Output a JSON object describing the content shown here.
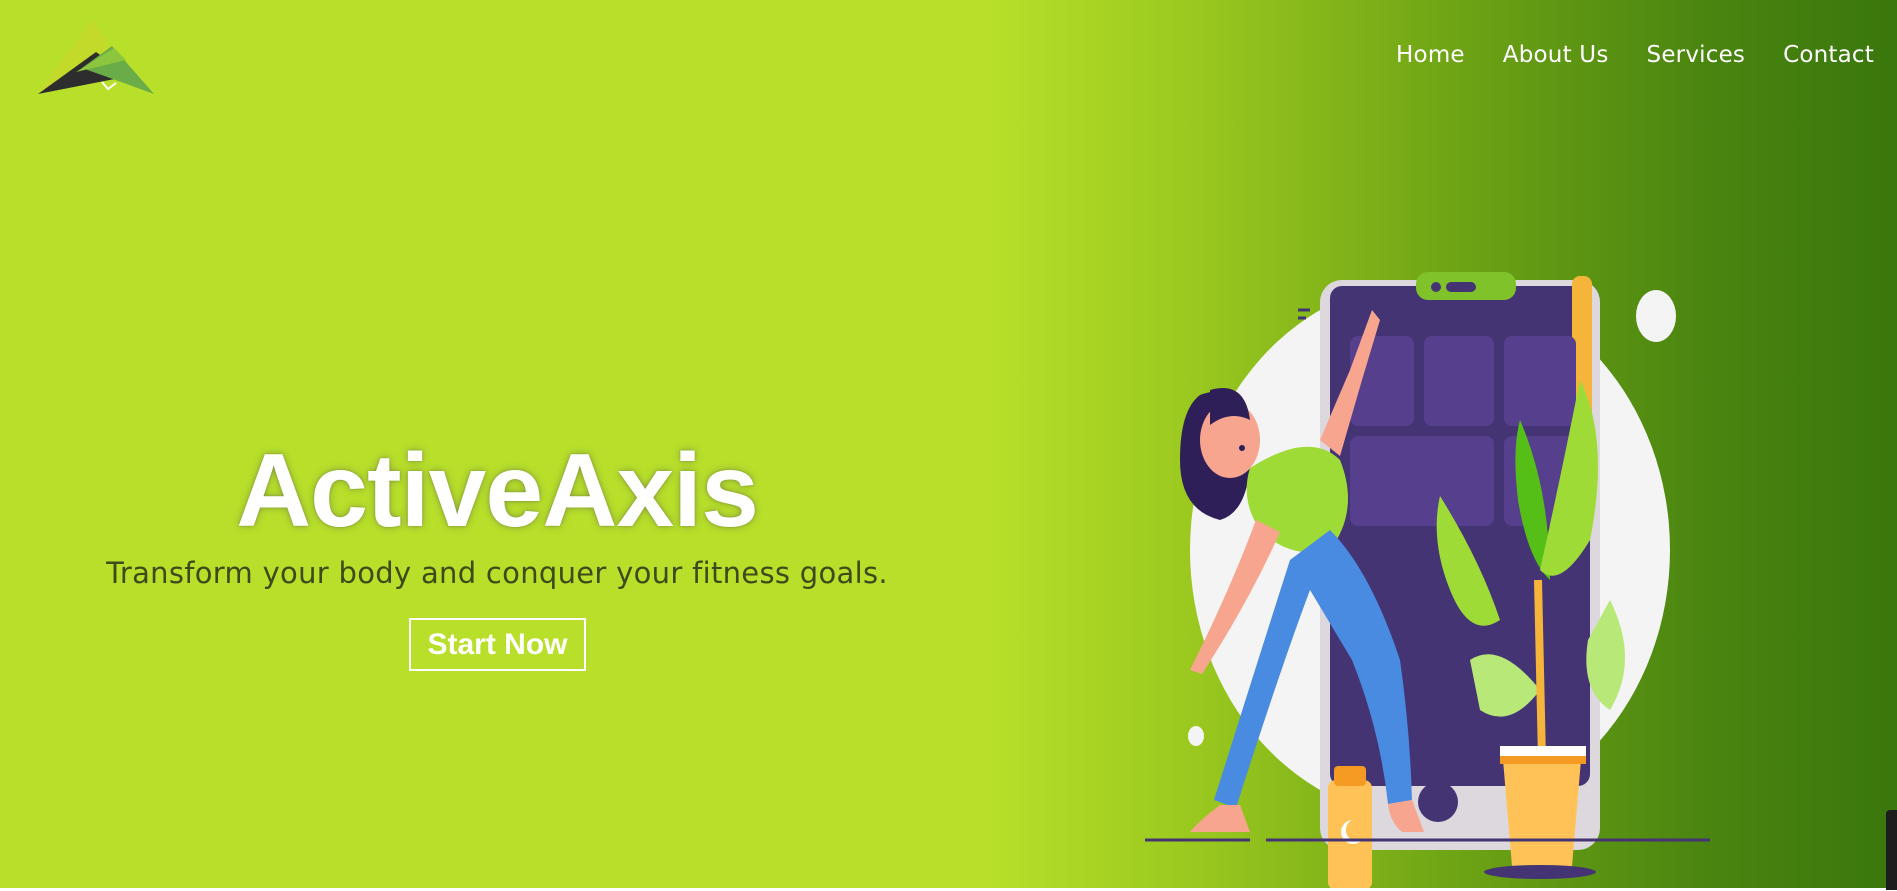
{
  "brand": {
    "name": "ActiveAxis",
    "tagline": "Transform your body and conquer your fitness goals.",
    "cta_label": "Start Now"
  },
  "nav": {
    "items": [
      {
        "label": "Home"
      },
      {
        "label": "About Us"
      },
      {
        "label": "Services"
      },
      {
        "label": "Contact"
      }
    ]
  },
  "icons": {
    "logo": "mountain-logo-icon",
    "side_tab": "feedback-tab-icon"
  },
  "colors": {
    "hero_start": "#b8e02a",
    "hero_end": "#3a770c",
    "text_light": "#ffffff",
    "tagline": "#3f4a1a",
    "phone": "#443474",
    "shirt": "#9edb37",
    "jeans": "#4a8be2",
    "pot": "#ffc257"
  }
}
